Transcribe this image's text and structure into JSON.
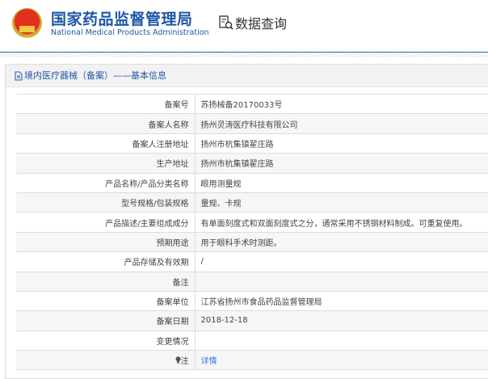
{
  "header": {
    "brand_cn": "国家药品监督管理局",
    "brand_en": "National Medical Products Administration",
    "section": "数据查询"
  },
  "panel": {
    "title": "境内医疗器械（备案）——基本信息"
  },
  "rows": [
    {
      "label": "备案号",
      "value": "苏扬械备20170033号"
    },
    {
      "label": "备案人名称",
      "value": "扬州灵涛医疗科技有限公司"
    },
    {
      "label": "备案人注册地址",
      "value": "扬州市杭集镇翟庄路"
    },
    {
      "label": "生产地址",
      "value": "扬州市杭集镇翟庄路"
    },
    {
      "label": "产品名称/产品分类名称",
      "value": "眼用测量规"
    },
    {
      "label": "型号规格/包装规格",
      "value": "量规、卡规"
    },
    {
      "label": "产品描述/主要组成成分",
      "value": "有单面刻度式和双面刻度式之分，通常采用不锈钢材料制成。可重复使用。"
    },
    {
      "label": "预期用途",
      "value": "用于眼科手术时测距。"
    },
    {
      "label": "产品存储及有效期",
      "value": "/"
    },
    {
      "label": "备注",
      "value": ""
    },
    {
      "label": "备案单位",
      "value": "江苏省扬州市食品药品监督管理局"
    },
    {
      "label": "备案日期",
      "value": "2018-12-18"
    },
    {
      "label": "变更情况",
      "value": ""
    }
  ],
  "note": {
    "label": "注",
    "link": "详情"
  },
  "colors": {
    "brand": "#1f57a6",
    "link": "#2a7de0"
  }
}
